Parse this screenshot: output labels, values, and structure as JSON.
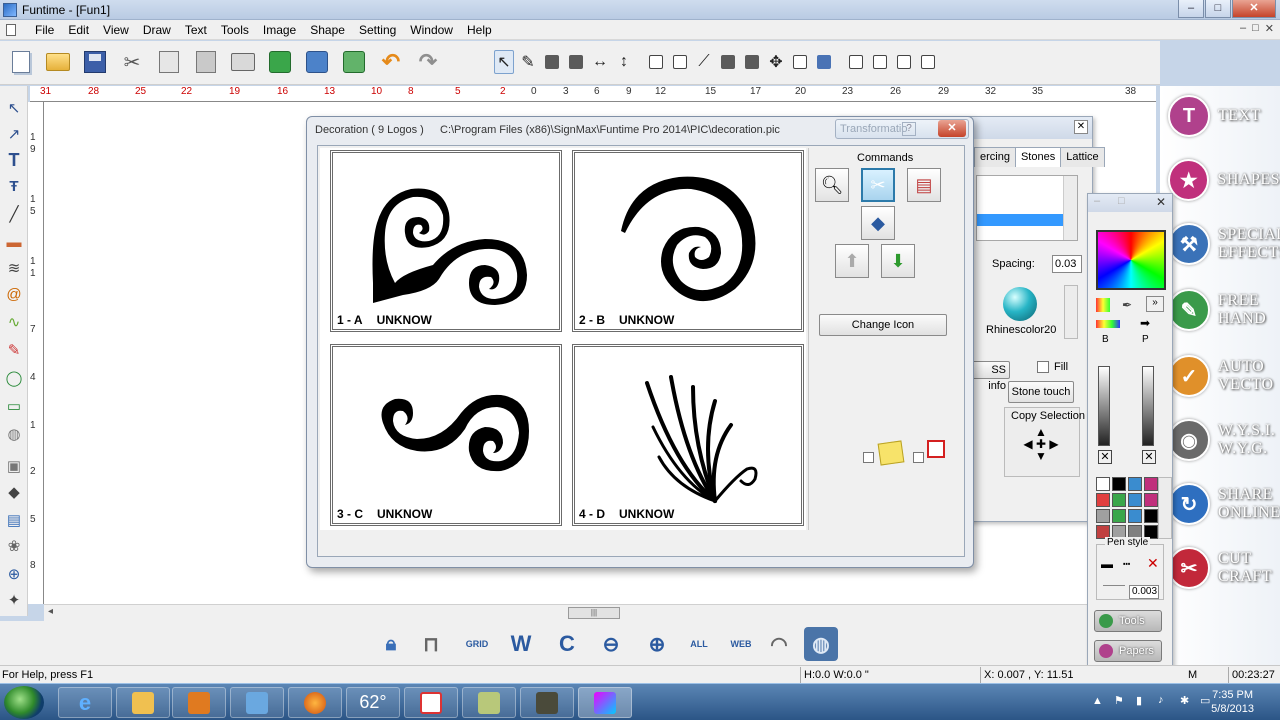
{
  "window": {
    "title": "Funtime - [Fun1]",
    "min": "–",
    "max": "□",
    "close": "✕"
  },
  "menu": [
    "File",
    "Edit",
    "View",
    "Draw",
    "Text",
    "Tools",
    "Image",
    "Shape",
    "Setting",
    "Window",
    "Help"
  ],
  "mdi": {
    "min": "–",
    "max": "□",
    "close": "✕"
  },
  "ruler": {
    "top_red": [
      "31",
      "28",
      "25",
      "22",
      "19",
      "16",
      "13",
      "10",
      "8",
      "5",
      "2"
    ],
    "top_black": [
      "0",
      "3",
      "6",
      "9",
      "12",
      "15",
      "17",
      "20",
      "23",
      "26",
      "29",
      "32",
      "35",
      "38"
    ],
    "left": [
      "1",
      "9",
      "1",
      "5",
      "1",
      "1",
      "7",
      "4",
      "1",
      "2",
      "5",
      "8"
    ]
  },
  "right_panel": {
    "buttons": [
      {
        "label": "TEXT",
        "letter": "T",
        "color": "#b0418c"
      },
      {
        "label": "SHAPES",
        "letter": "★",
        "color": "#c0307c"
      },
      {
        "label": "SPECIAL EFFECTS",
        "letter": "⚒",
        "color": "#3a72b8"
      },
      {
        "label": "FREE HAND",
        "letter": "✎",
        "color": "#3a9a4a"
      },
      {
        "label": "AUTO VECTO",
        "letter": "✓",
        "color": "#e0902a"
      },
      {
        "label": "W.Y.S.I. W.Y.G.",
        "letter": "◉",
        "color": "#6a6a6a"
      },
      {
        "label": "SHARE ONLINE",
        "letter": "↻",
        "color": "#2e6fc0"
      },
      {
        "label": "CUT CRAFT",
        "letter": "✂",
        "color": "#c2283a"
      }
    ]
  },
  "decoration": {
    "title": "Decoration ( 9 Logos )",
    "path": "C:\\Program Files (x86)\\SignMax\\Funtime Pro 2014\\PIC\\decoration.pic",
    "transform_title": "Transformatio",
    "help": "?",
    "close": "✕",
    "cells": [
      {
        "id": "1 - A",
        "name": "UNKNOW"
      },
      {
        "id": "2 - B",
        "name": "UNKNOW"
      },
      {
        "id": "3 - C",
        "name": "UNKNOW"
      },
      {
        "id": "4 - D",
        "name": "UNKNOW"
      }
    ],
    "commands_label": "Commands",
    "change_icon": "Change Icon"
  },
  "stones": {
    "close": "✕",
    "tabs": [
      "ercing",
      "Stones",
      "Lattice"
    ],
    "spacing_label": "Spacing:",
    "spacing_value": "0.03",
    "stone_name": "Rhinescolor20",
    "ss_info": "SS info",
    "fill_label": "Fill",
    "stone_touch": "Stone touch",
    "copy_selection": "Copy Selection"
  },
  "color_panel": {
    "min": "–",
    "max": "□",
    "close": "✕",
    "b_label": "B",
    "p_label": "P",
    "pen_style": "Pen style",
    "pen_value": "0.003",
    "tools": "Tools",
    "papers": "Papers",
    "swatches": [
      "#ffffff",
      "#000000",
      "#3a8ccf",
      "#c0307c",
      "#e04040",
      "#3aa64a",
      "#3a8ccf",
      "#c0307c",
      "#a0a0a0",
      "#3aa64a",
      "#3a8ccf",
      "#000000",
      "#c04040",
      "#a0a0a0",
      "#808080",
      "#000000"
    ]
  },
  "status": {
    "help": "For Help, press F1",
    "hw": "H:0.0   W:0.0 \"",
    "xy": "X: 0.007 , Y: 11.51",
    "mode": "M",
    "time": "00:23:27"
  },
  "taskbar": {
    "temp": "62°",
    "clock_time": "7:35 PM",
    "clock_date": "5/8/2013"
  },
  "viewbar": {
    "grid": "GRID",
    "w": "W",
    "c": "C",
    "all": "ALL",
    "web": "WEB"
  }
}
